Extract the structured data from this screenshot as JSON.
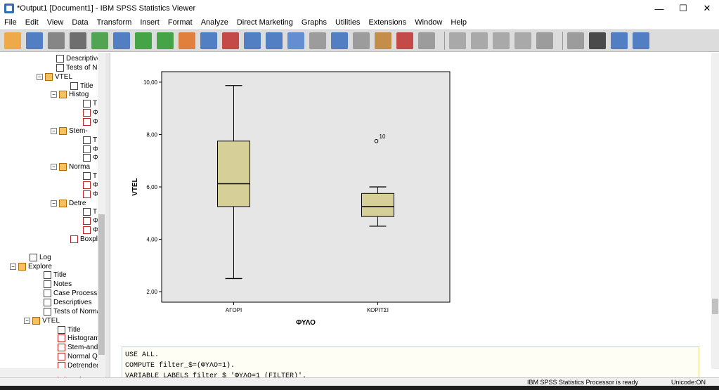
{
  "window": {
    "title": "*Output1 [Document1] - IBM SPSS Statistics Viewer",
    "controls": [
      "—",
      "☐",
      "✕"
    ]
  },
  "menu": [
    "File",
    "Edit",
    "View",
    "Data",
    "Transform",
    "Insert",
    "Format",
    "Analyze",
    "Direct Marketing",
    "Graphs",
    "Utilities",
    "Extensions",
    "Window",
    "Help"
  ],
  "toolbar": {
    "icons": [
      "open-icon",
      "save-icon",
      "print-icon",
      "print-preview-icon",
      "export-icon",
      "recall-dialog-icon",
      "undo-icon",
      "redo-icon",
      "goto-data-icon",
      "goto-case-icon",
      "goto-variable-icon",
      "variables-icon",
      "select-cases-icon",
      "value-labels-icon",
      "use-sets-icon",
      "insert-output-icon",
      "insert-heading-icon",
      "insert-title-icon",
      "insert-text-icon",
      "designate-window-icon",
      "back-icon",
      "forward-icon",
      "expand-icon",
      "collapse-icon",
      "show-icon",
      "hide-icon",
      "insert-page-break-icon",
      "insert-new-heading-icon",
      "insert-table-icon"
    ]
  },
  "outline": {
    "items": [
      {
        "label": "Descriptive",
        "icon": "table",
        "indent": 80,
        "expander": ""
      },
      {
        "label": "Tests of No",
        "icon": "table",
        "indent": 80,
        "expander": ""
      },
      {
        "label": "VTEL",
        "icon": "book",
        "indent": 66,
        "expander": "−"
      },
      {
        "label": "Title",
        "icon": "table",
        "indent": 100,
        "expander": ""
      },
      {
        "label": "Histog",
        "icon": "book",
        "indent": 86,
        "expander": "−"
      },
      {
        "label": "T",
        "icon": "table",
        "indent": 118,
        "expander": ""
      },
      {
        "label": "Φ",
        "icon": "chart",
        "indent": 118,
        "expander": ""
      },
      {
        "label": "Φ",
        "icon": "chart",
        "indent": 118,
        "expander": ""
      },
      {
        "label": "Stem-",
        "icon": "book",
        "indent": 86,
        "expander": "−"
      },
      {
        "label": "T",
        "icon": "table",
        "indent": 118,
        "expander": ""
      },
      {
        "label": "Φ",
        "icon": "table",
        "indent": 118,
        "expander": ""
      },
      {
        "label": "Φ",
        "icon": "table",
        "indent": 118,
        "expander": ""
      },
      {
        "label": "Norma",
        "icon": "book",
        "indent": 86,
        "expander": "−"
      },
      {
        "label": "T",
        "icon": "table",
        "indent": 118,
        "expander": ""
      },
      {
        "label": "Φ",
        "icon": "chart",
        "indent": 118,
        "expander": ""
      },
      {
        "label": "Φ",
        "icon": "chart",
        "indent": 118,
        "expander": ""
      },
      {
        "label": "Detre",
        "icon": "book",
        "indent": 86,
        "expander": "−"
      },
      {
        "label": "T",
        "icon": "table",
        "indent": 118,
        "expander": ""
      },
      {
        "label": "Φ",
        "icon": "chart",
        "indent": 118,
        "expander": ""
      },
      {
        "label": "Φ",
        "icon": "chart",
        "indent": 118,
        "expander": ""
      },
      {
        "label": "Boxplo",
        "icon": "chart",
        "indent": 100,
        "expander": ""
      },
      {
        "label": "",
        "icon": "",
        "indent": 0,
        "expander": ""
      },
      {
        "label": "Log",
        "icon": "table",
        "indent": 42,
        "expander": ""
      },
      {
        "label": "Explore",
        "icon": "book",
        "indent": 28,
        "expander": "−"
      },
      {
        "label": "Title",
        "icon": "table",
        "indent": 62,
        "expander": ""
      },
      {
        "label": "Notes",
        "icon": "table",
        "indent": 62,
        "expander": ""
      },
      {
        "label": "Case Processi",
        "icon": "table",
        "indent": 62,
        "expander": ""
      },
      {
        "label": "Descriptives",
        "icon": "table",
        "indent": 62,
        "expander": ""
      },
      {
        "label": "Tests of Norma",
        "icon": "table",
        "indent": 62,
        "expander": ""
      },
      {
        "label": "VTEL",
        "icon": "book",
        "indent": 48,
        "expander": "−"
      },
      {
        "label": "Title",
        "icon": "table",
        "indent": 82,
        "expander": ""
      },
      {
        "label": "Histogram",
        "icon": "chart",
        "indent": 82,
        "expander": ""
      },
      {
        "label": "Stem-and-",
        "icon": "chart",
        "indent": 82,
        "expander": ""
      },
      {
        "label": "Normal Q-",
        "icon": "chart",
        "indent": 82,
        "expander": ""
      },
      {
        "label": "Detrended",
        "icon": "chart",
        "indent": 82,
        "expander": ""
      },
      {
        "label": "Boxplot",
        "icon": "chart",
        "indent": 82,
        "expander": ""
      }
    ]
  },
  "chart_data": {
    "type": "box",
    "xlabel": "ΦΥΛΟ",
    "ylabel": "VTEL",
    "ylim": [
      1.6,
      10.4
    ],
    "yticks": [
      "2,00",
      "4,00",
      "6,00",
      "8,00",
      "10,00"
    ],
    "ytick_values": [
      2,
      4,
      6,
      8,
      10
    ],
    "fill": "#d6cf98",
    "background": "#e6e6e6",
    "categories": [
      "ΑΓΟΡΙ",
      "ΚΟΡΙΤΣΙ"
    ],
    "boxes": [
      {
        "category": "ΑΓΟΡΙ",
        "min": 2.5,
        "q1": 5.25,
        "median": 6.12,
        "q3": 7.75,
        "max": 9.87,
        "outliers": []
      },
      {
        "category": "ΚΟΡΙΤΣΙ",
        "min": 4.5,
        "q1": 4.87,
        "median": 5.25,
        "q3": 5.75,
        "max": 6.0,
        "outliers": [
          {
            "value": 7.75,
            "label": "10"
          }
        ]
      }
    ]
  },
  "syntax": {
    "lines": [
      "USE ALL.",
      "COMPUTE filter_$=(ΦΥΛΟ=1).",
      "VARIABLE LABELS filter_$ 'ΦΥΛΟ=1 (FILTER)'."
    ]
  },
  "status": {
    "processor": "IBM SPSS Statistics Processor is ready",
    "unicode": "Unicode:ON"
  }
}
